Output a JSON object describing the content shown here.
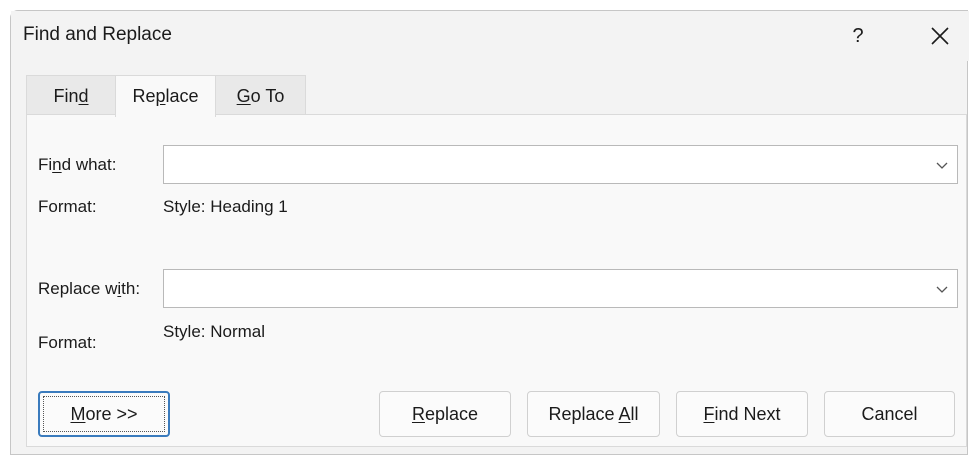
{
  "window": {
    "title": "Find and Replace",
    "help_label": "?"
  },
  "tabs": [
    {
      "label_pre": "Fin",
      "label_u": "d",
      "label_post": "",
      "active": false
    },
    {
      "label_pre": "Re",
      "label_u": "p",
      "label_post": "lace",
      "active": true
    },
    {
      "label_pre": "",
      "label_u": "G",
      "label_post": "o To",
      "active": false
    }
  ],
  "find": {
    "label_pre": "Fi",
    "label_u": "n",
    "label_post": "d what:",
    "value": "",
    "format_label": "Format:",
    "format_value": "Style: Heading 1"
  },
  "replace": {
    "label_pre": "Replace w",
    "label_u": "i",
    "label_post": "th:",
    "value": "",
    "format_label": "Format:",
    "format_value": "Style: Normal"
  },
  "buttons": {
    "more": {
      "pre": "",
      "u": "M",
      "post": "ore >>"
    },
    "replace": {
      "pre": "",
      "u": "R",
      "post": "eplace"
    },
    "replace_all": {
      "pre": "Replace ",
      "u": "A",
      "post": "ll"
    },
    "find_next": {
      "pre": "",
      "u": "F",
      "post": "ind Next"
    },
    "cancel": {
      "pre": "Cancel",
      "u": "",
      "post": ""
    }
  },
  "colors": {
    "default_button_border": "#3a7bbd",
    "dialog_bg": "#f3f3f3"
  }
}
